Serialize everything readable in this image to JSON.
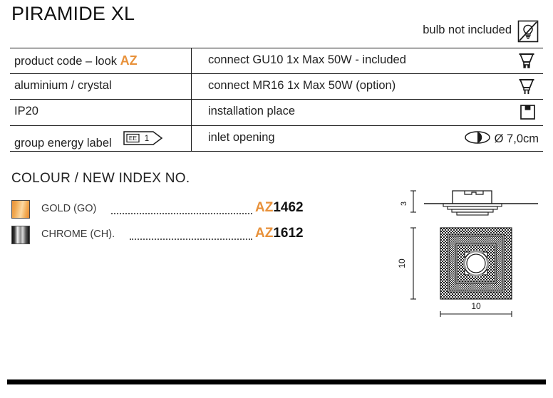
{
  "header": {
    "title": "PIRAMIDE XL",
    "bulb_note": "bulb not included",
    "bulb_icon": "bulb-not-included-icon"
  },
  "spec_table": {
    "rows": [
      {
        "left": "product code – look ",
        "left_accent": "AZ",
        "right": "connect GU10 1x Max 50W - included",
        "right_icon": "gu10-bulb-icon"
      },
      {
        "left": "aluminium / crystal",
        "right": "connect MR16 1x Max 50W (option)",
        "right_icon": "mr16-bulb-icon"
      },
      {
        "left": "IP20",
        "right": "installation place",
        "right_icon": "installation-place-icon"
      },
      {
        "left": "group energy label",
        "left_badge": {
          "prefix": "EE",
          "value": "1"
        },
        "right": "inlet opening",
        "right_icon": "inlet-opening-icon",
        "right_value": "Ø 7,0cm"
      }
    ]
  },
  "colour_section": {
    "heading": "COLOUR / NEW INDEX NO.",
    "items": [
      {
        "swatch": "gold-swatch",
        "name": "GOLD (GO)",
        "code_prefix": "AZ",
        "code_number": "1462"
      },
      {
        "swatch": "chrome-swatch",
        "name": "CHROME (CH).",
        "code_prefix": "AZ",
        "code_number": "1612"
      }
    ]
  },
  "technical_drawing": {
    "side_view_height": "3",
    "top_view_height": "10",
    "top_view_width": "10"
  },
  "colors": {
    "accent_orange": "#E8913A",
    "text": "#222222",
    "rule": "#1A1A1A",
    "bar": "#000000"
  }
}
